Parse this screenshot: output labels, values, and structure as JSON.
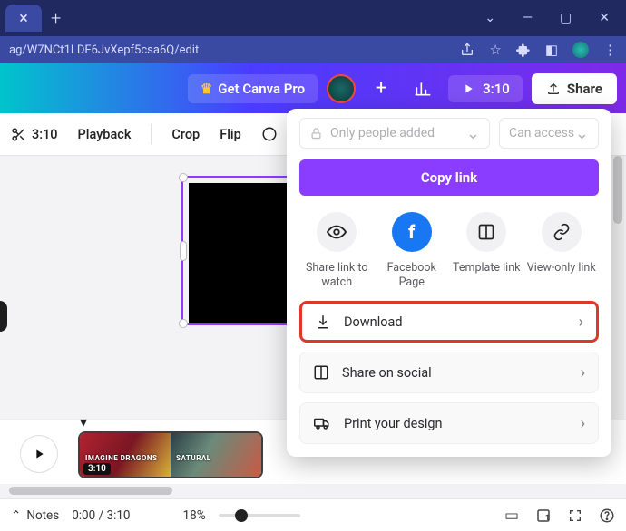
{
  "browser": {
    "url_fragment": "ag/W7NCt1LDF6JvXepf5csa6Q/edit"
  },
  "header": {
    "pro_label": "Get Canva Pro",
    "play_time": "3:10",
    "share_label": "Share"
  },
  "toolbar": {
    "time": "3:10",
    "playback": "Playback",
    "crop": "Crop",
    "flip": "Flip"
  },
  "share_panel": {
    "access_sel1": "Only people added",
    "access_sel2": "Can access",
    "copy_link": "Copy link",
    "grid": {
      "watch": "Share link to watch",
      "facebook": "Facebook Page",
      "template": "Template link",
      "viewonly": "View-only link"
    },
    "list": {
      "download": "Download",
      "share_social": "Share on social",
      "print": "Print your design"
    }
  },
  "timeline": {
    "clip1_title": "IMAGINE DRAGONS",
    "clip2_title": "SATURAL",
    "clip1_time": "3:10"
  },
  "bottom": {
    "notes": "Notes",
    "time": "0:00 / 3:10",
    "zoom": "18%"
  }
}
